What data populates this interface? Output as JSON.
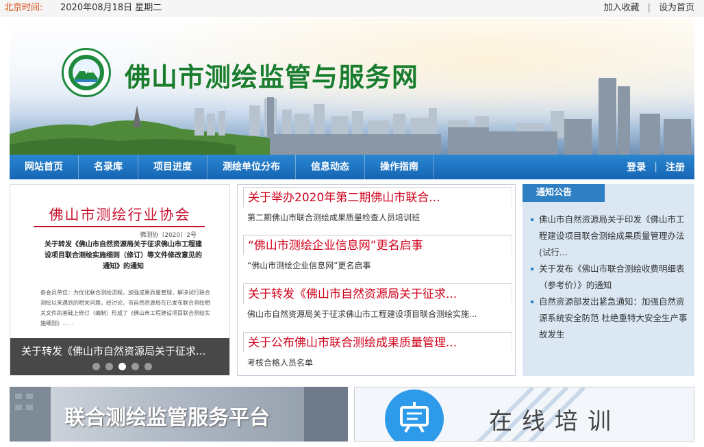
{
  "topbar": {
    "time_label": "北京时间:",
    "time_value": "2020年08月18日 星期二",
    "favorite": "加入收藏",
    "separator": "|",
    "homepage": "设为首页"
  },
  "banner": {
    "site_title": "佛山市测绘监管与服务网"
  },
  "nav": {
    "items": [
      "网站首页",
      "名录库",
      "项目进度",
      "测绘单位分布",
      "信息动态",
      "操作指南"
    ],
    "login": "登录",
    "register": "注册",
    "auth_sep": "|"
  },
  "slider": {
    "doc_header": "佛山市测绘行业协会",
    "doc_number": "佛测协〔2020〕2号",
    "doc_title": "关于转发《佛山市自然资源局关于征求佛山市工程建设项目联合测绘实施细则（修订）等文件修改意见的通知》的通知",
    "doc_body": "各会员单位：为优化联合测绘流程，加强成果质量管理，解决试行联合测绘以来遇到的相关问题，经讨论，市自然资源局在已发布联合测绘相关文件的基础上修订（编制）形成了《佛山市工程建设项目联合测绘实施细则》……",
    "caption": "关于转发《佛山市自然资源局关于征求...",
    "dots": 5,
    "active_dot": 3
  },
  "news": [
    {
      "title": "关于举办2020年第二期佛山市联合...",
      "summary": "第二期佛山市联合测绘成果质量检查人员培训班"
    },
    {
      "title": "“佛山市测绘企业信息网”更名启事",
      "summary": "“佛山市测绘企业信息网”更名启事"
    },
    {
      "title": "关于转发《佛山市自然资源局关于征求...",
      "summary": "佛山市自然资源局关于征求佛山市工程建设项目联合测绘实施..."
    },
    {
      "title": "关于公布佛山市联合测绘成果质量管理...",
      "summary": "考核合格人员名单"
    }
  ],
  "notice": {
    "heading": "通知公告",
    "items": [
      "佛山市自然资源局关于印发《佛山市工程建设项目联合测绘成果质量管理办法(试行...",
      "关于发布《佛山市联合测绘收费明细表（参考价）》的通知",
      "自然资源部发出紧急通知：加强自然资源系统安全防范 杜绝重特大安全生产事故发生"
    ]
  },
  "platform": {
    "label": "联合测绘监管服务平台"
  },
  "training": {
    "label": "在线培训"
  },
  "colors": {
    "nav": "#1f78c8",
    "title_green": "#1a7d2e",
    "headline_red": "#d0021b",
    "notice_bg": "#dbe8f4"
  }
}
